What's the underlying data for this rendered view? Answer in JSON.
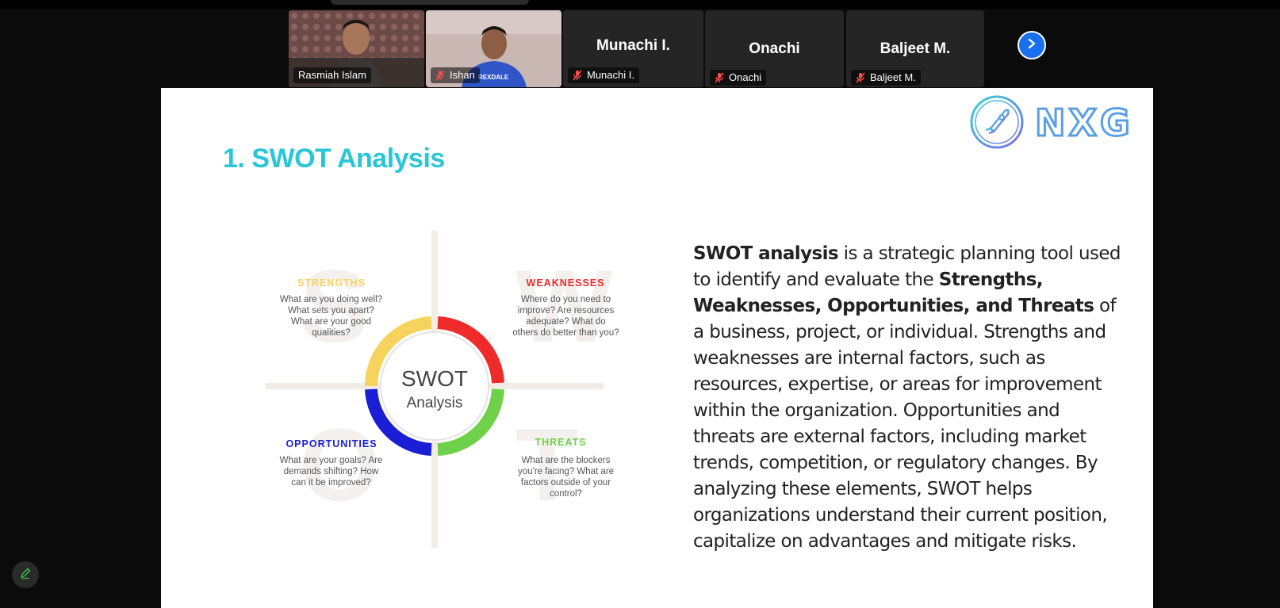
{
  "meeting": {
    "participants": [
      {
        "name": "Rasmiah Islam",
        "camera_on": true,
        "muted": false,
        "active_speaker": true
      },
      {
        "name": "Ishan",
        "camera_on": true,
        "muted": true,
        "active_speaker": false
      },
      {
        "name": "Munachi I.",
        "camera_on": false,
        "muted": true,
        "active_speaker": false
      },
      {
        "name": "Onachi",
        "camera_on": false,
        "muted": true,
        "active_speaker": false
      },
      {
        "name": "Baljeet M.",
        "camera_on": false,
        "muted": true,
        "active_speaker": false
      }
    ],
    "shirt_text": "REXDALE",
    "next_page_icon": "chevron-right-icon",
    "annotate_icon": "pencil-icon"
  },
  "slide": {
    "title": "1. SWOT Analysis",
    "logo_text": "NXG",
    "diagram": {
      "center_line1": "SWOT",
      "center_line2": "Analysis",
      "strengths": {
        "heading": "STRENGTHS",
        "letter": "S",
        "text": "What are you doing well? What sets you apart? What are your good qualities?",
        "color": "#f6d35c"
      },
      "weaknesses": {
        "heading": "WEAKNESSES",
        "letter": "W",
        "text": "Where do you need to improve? Are resources adequate? What do others do better than you?",
        "color": "#ee2a2a"
      },
      "opportunities": {
        "heading": "OPPORTUNITIES",
        "letter": "O",
        "text": "What are your goals? Are demands shifting? How can it be improved?",
        "color": "#1a1fd6"
      },
      "threats": {
        "heading": "THREATS",
        "letter": "T",
        "text": "What are the blockers you're facing? What are factors outside of your control?",
        "color": "#6fd04a"
      }
    },
    "description": {
      "bold1": "SWOT analysis",
      "text1": " is a strategic planning tool used to identify and evaluate the ",
      "bold2": "Strengths, Weaknesses, Opportunities, and Threats",
      "text2": " of a business, project, or individual. Strengths and weaknesses are internal factors, such as resources, expertise, or areas for improvement within the organization. Opportunities and threats are external factors, including market trends, competition, or regulatory changes. By analyzing these elements, SWOT helps organizations understand their current position, capitalize on advantages and mitigate risks."
    }
  },
  "colors": {
    "title": "#29c7d6",
    "active_speaker_border": "#3ec24d",
    "next_button": "#1a6ff0"
  }
}
